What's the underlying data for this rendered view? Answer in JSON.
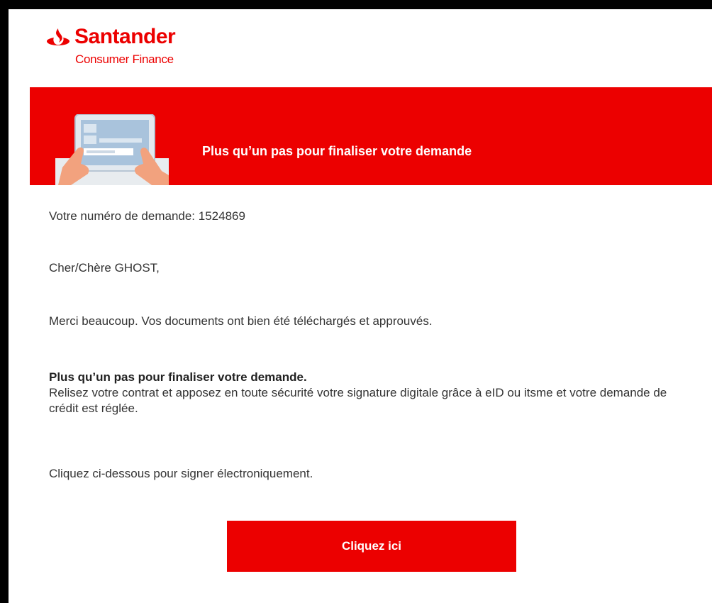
{
  "header": {
    "brand": "Santander",
    "sub_brand": "Consumer Finance",
    "logo_icon": "santander-flame-icon",
    "brand_color": "#ec0000"
  },
  "banner": {
    "title": "Plus qu’un pas pour finaliser votre demande",
    "illustration": "hands-holding-tablet-illustration",
    "background_color": "#ec0000"
  },
  "body": {
    "request_number_text": "Votre numéro de demande: 1524869",
    "greeting": "Cher/Chère GHOST,",
    "thanks": "Merci beaucoup. Vos documents ont bien été téléchargés et approuvés.",
    "step_heading": "Plus qu’un pas pour finaliser votre demande.",
    "step_text": "Relisez votre contrat et apposez en toute sécurité votre signature digitale grâce à eID ou itsme et votre demande de crédit est réglée.",
    "click_instruction": "Cliquez ci-dessous pour signer électroniquement."
  },
  "cta": {
    "label": "Cliquez ici"
  }
}
